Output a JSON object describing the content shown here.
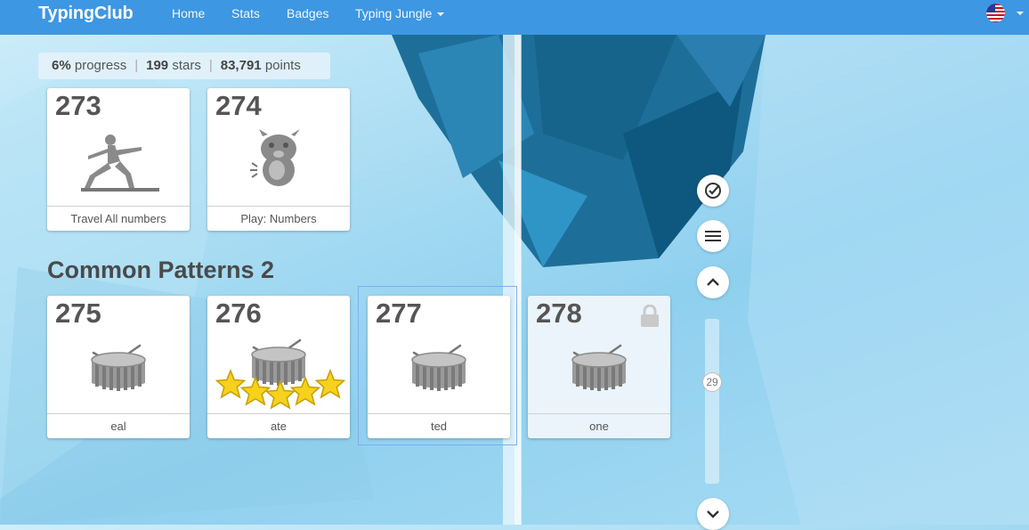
{
  "nav": {
    "brand": "TypingClub",
    "home": "Home",
    "stats": "Stats",
    "badges": "Badges",
    "typing_jungle": "Typing Jungle"
  },
  "progress": {
    "percent": "6%",
    "percent_label": "progress",
    "stars": "199",
    "stars_label": "stars",
    "points": "83,791",
    "points_label": "points"
  },
  "lessons_top": [
    {
      "num": "273",
      "label": "Travel All numbers",
      "icon": "yoga-pose-icon"
    },
    {
      "num": "274",
      "label": "Play: Numbers",
      "icon": "monster-icon"
    }
  ],
  "section": {
    "title": "Common Patterns 2"
  },
  "lessons": [
    {
      "num": "275",
      "label": "eal",
      "icon": "drum-icon",
      "stars": 0,
      "locked": false
    },
    {
      "num": "276",
      "label": "ate",
      "icon": "drum-icon",
      "stars": 5,
      "locked": false
    },
    {
      "num": "277",
      "label": "ted",
      "icon": "drum-icon",
      "stars": 0,
      "locked": false,
      "selected": true
    },
    {
      "num": "278",
      "label": "one",
      "icon": "drum-icon",
      "stars": 0,
      "locked": true
    }
  ],
  "side": {
    "level": "29"
  },
  "colors": {
    "nav": "#3d97e3",
    "accent": "#7fb0ec"
  }
}
